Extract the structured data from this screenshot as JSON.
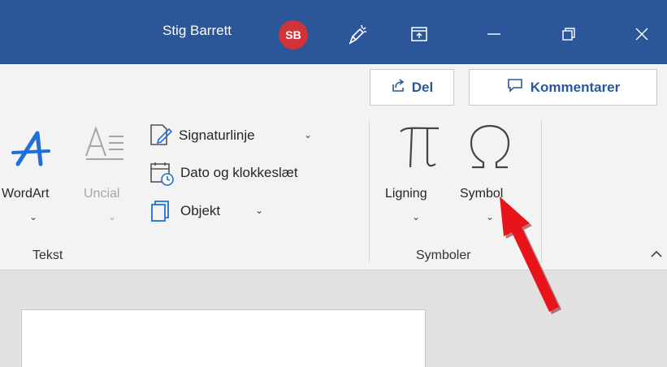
{
  "titlebar": {
    "user_name": "Stig Barrett",
    "avatar_initials": "SB",
    "accent": "#2b579a",
    "avatar_color": "#d13438"
  },
  "actions": {
    "share_label": "Del",
    "comments_label": "Kommentarer"
  },
  "ribbon": {
    "text_group": {
      "label": "Tekst",
      "wordart_label": "WordArt",
      "dropcap_label": "Uncial",
      "signature_label": "Signaturlinje",
      "date_label": "Dato og klokkeslæt",
      "object_label": "Objekt"
    },
    "symbols_group": {
      "label": "Symboler",
      "equation_label": "Ligning",
      "symbol_label": "Symbol"
    }
  },
  "annotation": {
    "arrow_color": "#e8141a"
  }
}
